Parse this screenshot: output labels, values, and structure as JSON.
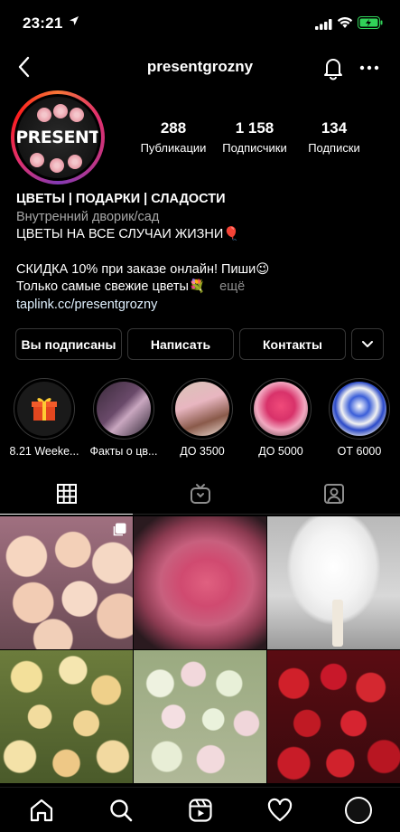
{
  "status_bar": {
    "time": "23:21"
  },
  "nav": {
    "title": "presentgrozny"
  },
  "avatar": {
    "logo_text": "PRESENT"
  },
  "stats": [
    {
      "value": "288",
      "label": "Публикации"
    },
    {
      "value": "1 158",
      "label": "Подписчики"
    },
    {
      "value": "134",
      "label": "Подписки"
    }
  ],
  "bio": {
    "name": "ЦВЕТЫ | ПОДАРКИ | СЛАДОСТИ",
    "category": "Внутренний дворик/сад",
    "line1": "ЦВЕТЫ НА ВСЕ СЛУЧАИ ЖИЗНИ🎈",
    "line2": "СКИДКА 10% при заказе онлайн! Пиши😉",
    "line3": "Только самые свежие цветы💐",
    "more": "ещё",
    "link": "taplink.cc/presentgrozny"
  },
  "buttons": {
    "following": "Вы подписаны",
    "message": "Написать",
    "contacts": "Контакты"
  },
  "highlights": [
    {
      "label": "8.21 Weeke..."
    },
    {
      "label": "Факты о цв..."
    },
    {
      "label": "ДО 3500"
    },
    {
      "label": "ДО 5000"
    },
    {
      "label": "ОТ 6000"
    }
  ],
  "colors": {
    "background": "#000000",
    "border": "#363636",
    "link": "#e0f1ff",
    "muted": "#a8a8a8"
  }
}
